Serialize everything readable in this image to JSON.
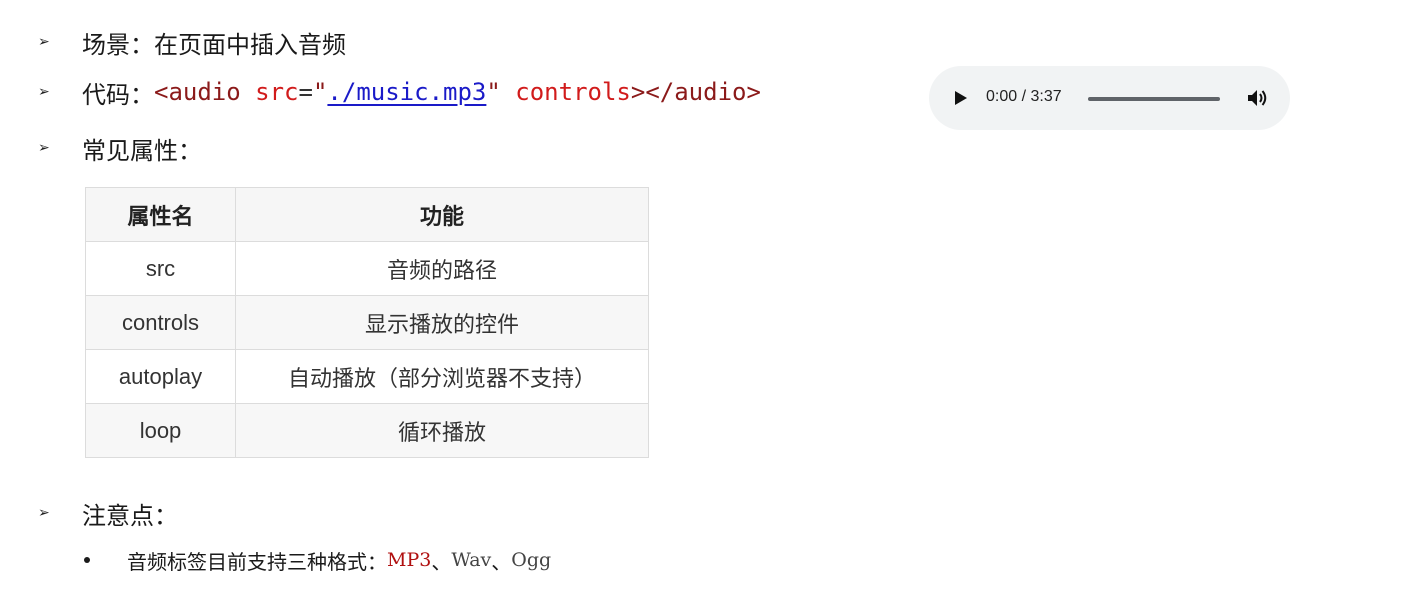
{
  "bullets": {
    "scene": "场景：在页面中插入音频",
    "code_label": "代码：",
    "code": {
      "open_tag": "<audio",
      "attr_src": "src",
      "eq": "=",
      "quote_open": "\"",
      "src_value": "./music.mp3",
      "quote_close": "\"",
      "attr_controls": "controls",
      "close": "></audio>"
    },
    "common_attrs": "常见属性：",
    "notes": "注意点："
  },
  "audio_player": {
    "time": "0:00 / 3:37",
    "progress": 0.0
  },
  "table": {
    "headers": [
      "属性名",
      "功能"
    ],
    "rows": [
      [
        "src",
        "音频的路径"
      ],
      [
        "controls",
        "显示播放的控件"
      ],
      [
        "autoplay",
        "自动播放（部分浏览器不支持）"
      ],
      [
        "loop",
        "循环播放"
      ]
    ]
  },
  "note_item": {
    "label": "音频标签目前支持三种格式：",
    "mp3": "MP3",
    "sep1": "、",
    "wav": "Wav",
    "sep2": "、",
    "ogg": "Ogg"
  },
  "icons": {
    "bullet": "arrowhead-bullet-icon",
    "play": "play-icon",
    "volume": "volume-icon"
  }
}
